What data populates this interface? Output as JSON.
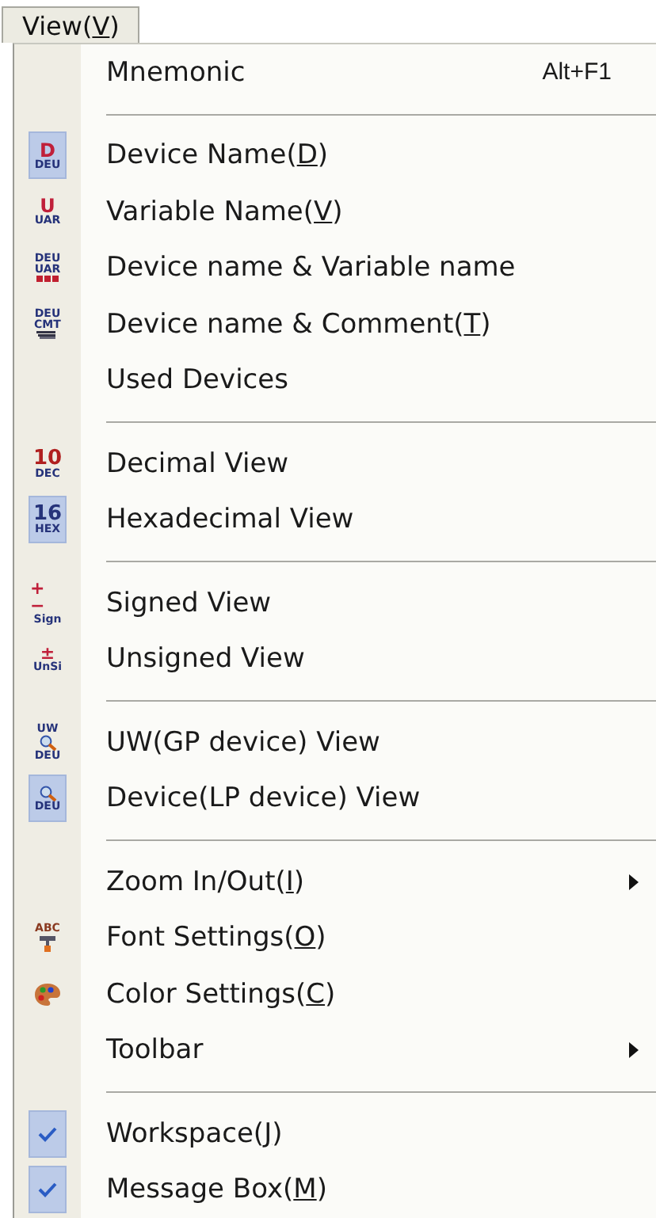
{
  "menu_title": {
    "label": "View(",
    "access_key": "V",
    "suffix": ")"
  },
  "groups": [
    {
      "items": [
        {
          "kind": "plain",
          "label": "Mnemonic",
          "shortcut": "Alt+F1"
        }
      ]
    },
    {
      "items": [
        {
          "kind": "tag",
          "icon_text": [
            "D",
            "DEU"
          ],
          "checked": true,
          "label": "Device Name(",
          "access_key": "D",
          "suffix": ")"
        },
        {
          "kind": "tag",
          "icon_text": [
            "U",
            "UAR"
          ],
          "checked": false,
          "label": "Variable Name(",
          "access_key": "V",
          "suffix": ")"
        },
        {
          "kind": "variable-stack",
          "icon_text": [
            "DEU",
            "UAR"
          ],
          "checked": false,
          "label": "Device name & Variable name"
        },
        {
          "kind": "comment-stack",
          "icon_text": [
            "DEU",
            "CMT"
          ],
          "checked": false,
          "label": "Device name & Comment(",
          "access_key": "T",
          "suffix": ")"
        },
        {
          "kind": "plain",
          "label": "Used Devices"
        }
      ]
    },
    {
      "items": [
        {
          "kind": "decimal",
          "icon_text": [
            "10",
            "DEC"
          ],
          "checked": false,
          "label": "Decimal View"
        },
        {
          "kind": "hex",
          "icon_text": [
            "16",
            "HEX"
          ],
          "checked": true,
          "label": "Hexadecimal View"
        }
      ]
    },
    {
      "items": [
        {
          "kind": "sign",
          "icon_text": [
            "+ −",
            "Sign"
          ],
          "checked": false,
          "label": "Signed View"
        },
        {
          "kind": "sign",
          "icon_text": [
            "±",
            "UnSi"
          ],
          "checked": false,
          "label": "Unsigned View"
        }
      ]
    },
    {
      "items": [
        {
          "kind": "magnifier",
          "icon_text": [
            "UW",
            "DEU"
          ],
          "checked": false,
          "label": "UW(GP device) View"
        },
        {
          "kind": "magnifier",
          "icon_text": [
            "DEU"
          ],
          "checked": true,
          "label": "Device(LP device) View"
        }
      ]
    },
    {
      "items": [
        {
          "kind": "submenu",
          "label": "Zoom In/Out(",
          "access_key": "I",
          "suffix": ")"
        },
        {
          "kind": "font",
          "icon_text": [
            "ABC"
          ],
          "label": "Font Settings(",
          "access_key": "O",
          "suffix": ")"
        },
        {
          "kind": "palette",
          "label": "Color Settings(",
          "access_key": "C",
          "suffix": ")"
        },
        {
          "kind": "submenu",
          "label": "Toolbar"
        }
      ]
    },
    {
      "items": [
        {
          "kind": "check",
          "checked": true,
          "label": "Workspace(",
          "access_key": "J",
          "suffix": ")"
        },
        {
          "kind": "check",
          "checked": true,
          "label": "Message Box(",
          "access_key": "M",
          "suffix": ")"
        }
      ]
    }
  ]
}
